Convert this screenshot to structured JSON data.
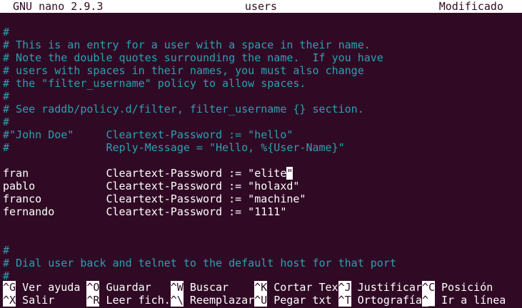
{
  "titlebar": {
    "app": "GNU nano 2.9.3",
    "filename": "users",
    "status": "Modificado"
  },
  "editor": {
    "lines": [
      {
        "text": "#",
        "type": "comment"
      },
      {
        "text": "# This is an entry for a user with a space in their name.",
        "type": "comment"
      },
      {
        "text": "# Note the double quotes surrounding the name.  If you have",
        "type": "comment"
      },
      {
        "text": "# users with spaces in their names, you must also change",
        "type": "comment"
      },
      {
        "text": "# the \"filter_username\" policy to allow spaces.",
        "type": "comment"
      },
      {
        "text": "#",
        "type": "comment"
      },
      {
        "text": "# See raddb/policy.d/filter, filter_username {} section.",
        "type": "comment"
      },
      {
        "text": "#",
        "type": "comment"
      },
      {
        "text": "#\"John Doe\"     Cleartext-Password := \"hello\"",
        "type": "comment"
      },
      {
        "text": "#               Reply-Message = \"Hello, %{User-Name}\"",
        "type": "comment"
      },
      {
        "text": "",
        "type": "plain"
      },
      {
        "text": "fran            Cleartext-Password := \"elite",
        "type": "plain",
        "cursor_char": "\""
      },
      {
        "text": "pablo           Cleartext-Password := \"holaxd\"",
        "type": "plain"
      },
      {
        "text": "franco          Cleartext-Password := \"machine\"",
        "type": "plain"
      },
      {
        "text": "fernando        Cleartext-Password := \"1111\"",
        "type": "plain"
      },
      {
        "text": "",
        "type": "plain"
      },
      {
        "text": "",
        "type": "plain"
      },
      {
        "text": "#",
        "type": "comment"
      },
      {
        "text": "# Dial user back and telnet to the default host for that port",
        "type": "comment"
      },
      {
        "text": "#",
        "type": "comment"
      }
    ]
  },
  "shortcuts": {
    "row1": [
      {
        "key": "^G",
        "label": " Ver ayuda"
      },
      {
        "key": "^O",
        "label": " Guardar"
      },
      {
        "key": "^W",
        "label": " Buscar"
      },
      {
        "key": "^K",
        "label": " Cortar Tex"
      },
      {
        "key": "^J",
        "label": " Justificar"
      },
      {
        "key": "^C",
        "label": " Posición"
      }
    ],
    "row2": [
      {
        "key": "^X",
        "label": " Salir"
      },
      {
        "key": "^R",
        "label": " Leer fich."
      },
      {
        "key": "^\\",
        "label": " Reemplazar"
      },
      {
        "key": "^U",
        "label": " Pegar txt"
      },
      {
        "key": "^T",
        "label": " Ortografía"
      },
      {
        "key": "^_",
        "label": " Ir a línea"
      }
    ]
  }
}
